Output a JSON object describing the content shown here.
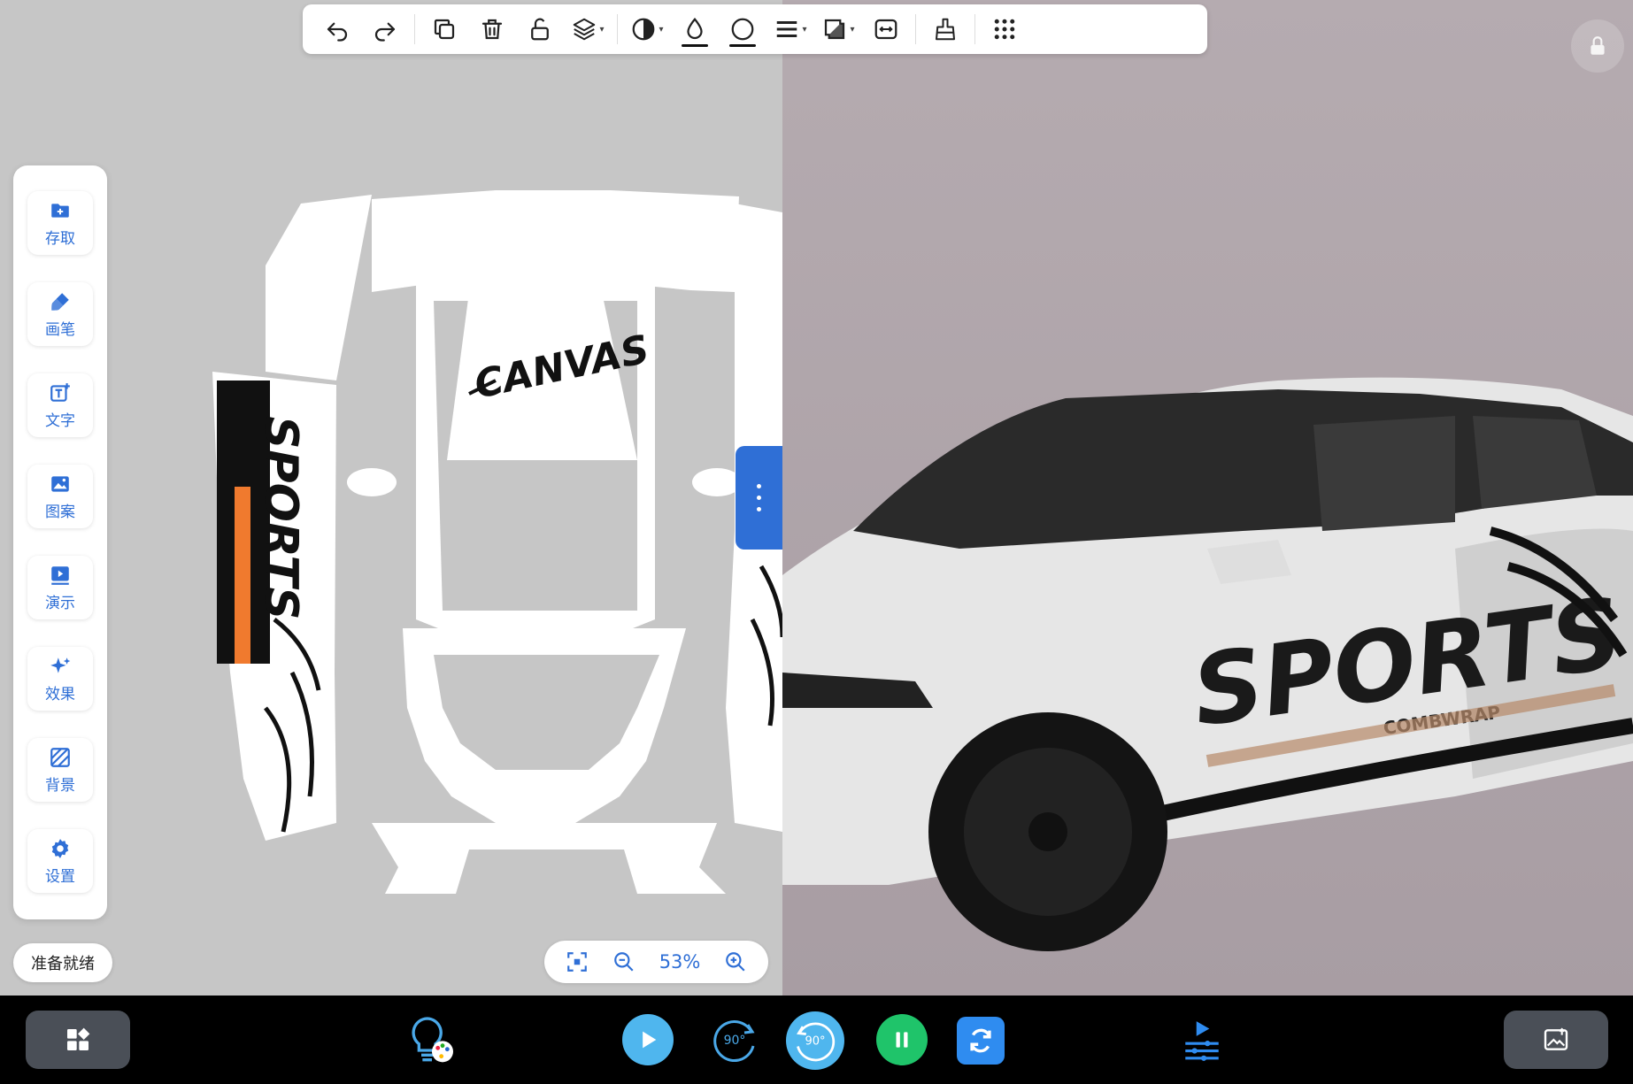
{
  "toolbar": {
    "items": [
      "undo-icon",
      "redo-icon",
      "copy-icon",
      "delete-icon",
      "unlock-icon",
      "layers-icon",
      "contrast-icon",
      "fill-color-icon",
      "stroke-color-icon",
      "line-weight-icon",
      "shadow-icon",
      "fit-width-icon",
      "eraser-icon",
      "apps-grid-icon"
    ]
  },
  "sidebar": {
    "items": [
      {
        "label": "存取",
        "icon": "folder-add-icon"
      },
      {
        "label": "画笔",
        "icon": "brush-icon"
      },
      {
        "label": "文字",
        "icon": "text-add-icon"
      },
      {
        "label": "图案",
        "icon": "image-icon"
      },
      {
        "label": "演示",
        "icon": "play-icon"
      },
      {
        "label": "效果",
        "icon": "sparkle-icon"
      },
      {
        "label": "背景",
        "icon": "background-icon"
      },
      {
        "label": "设置",
        "icon": "gear-icon"
      }
    ]
  },
  "status": {
    "text": "准备就绪"
  },
  "zoom": {
    "value": "53%"
  },
  "canvas": {
    "graffiti_text": "SPORTS",
    "sub_text": "COMBWRAP",
    "roof_tag": "CANVAS"
  },
  "bottom": {
    "rotate_left_label": "90°",
    "rotate_right_label": "90°"
  },
  "colors": {
    "accent": "#2f6fd6",
    "left_bg": "#c6c6c6",
    "right_bg": "#aea3a9",
    "bottom_bg": "#000000"
  }
}
